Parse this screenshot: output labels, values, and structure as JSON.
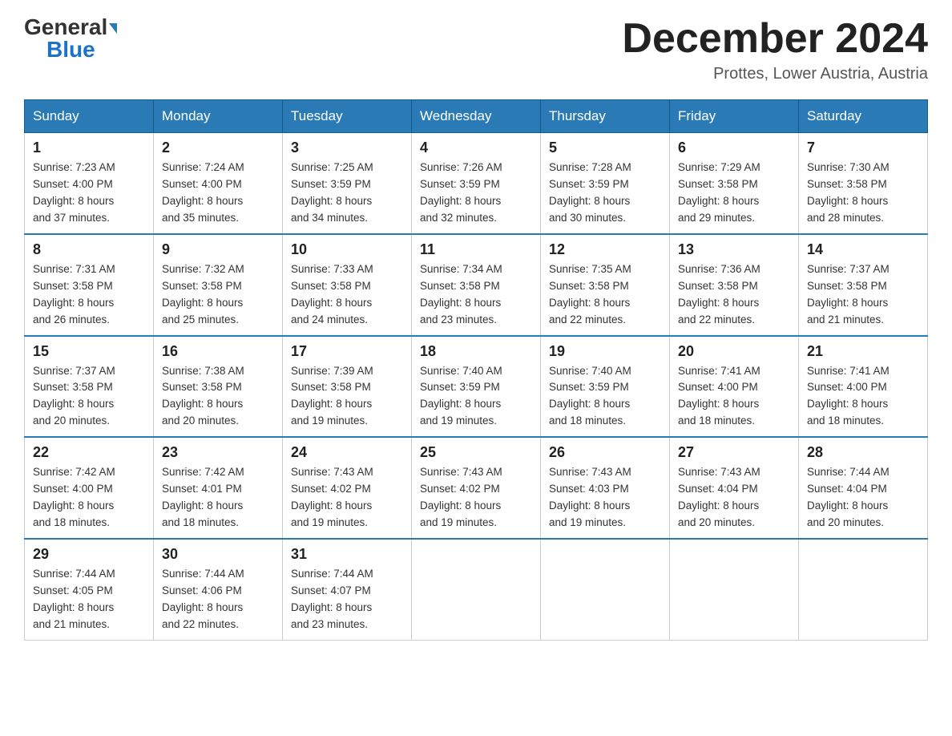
{
  "header": {
    "logo_general": "General",
    "logo_blue": "Blue",
    "month_title": "December 2024",
    "subtitle": "Prottes, Lower Austria, Austria"
  },
  "days_of_week": [
    "Sunday",
    "Monday",
    "Tuesday",
    "Wednesday",
    "Thursday",
    "Friday",
    "Saturday"
  ],
  "weeks": [
    [
      {
        "day": "1",
        "sunrise": "7:23 AM",
        "sunset": "4:00 PM",
        "daylight": "8 hours and 37 minutes."
      },
      {
        "day": "2",
        "sunrise": "7:24 AM",
        "sunset": "4:00 PM",
        "daylight": "8 hours and 35 minutes."
      },
      {
        "day": "3",
        "sunrise": "7:25 AM",
        "sunset": "3:59 PM",
        "daylight": "8 hours and 34 minutes."
      },
      {
        "day": "4",
        "sunrise": "7:26 AM",
        "sunset": "3:59 PM",
        "daylight": "8 hours and 32 minutes."
      },
      {
        "day": "5",
        "sunrise": "7:28 AM",
        "sunset": "3:59 PM",
        "daylight": "8 hours and 30 minutes."
      },
      {
        "day": "6",
        "sunrise": "7:29 AM",
        "sunset": "3:58 PM",
        "daylight": "8 hours and 29 minutes."
      },
      {
        "day": "7",
        "sunrise": "7:30 AM",
        "sunset": "3:58 PM",
        "daylight": "8 hours and 28 minutes."
      }
    ],
    [
      {
        "day": "8",
        "sunrise": "7:31 AM",
        "sunset": "3:58 PM",
        "daylight": "8 hours and 26 minutes."
      },
      {
        "day": "9",
        "sunrise": "7:32 AM",
        "sunset": "3:58 PM",
        "daylight": "8 hours and 25 minutes."
      },
      {
        "day": "10",
        "sunrise": "7:33 AM",
        "sunset": "3:58 PM",
        "daylight": "8 hours and 24 minutes."
      },
      {
        "day": "11",
        "sunrise": "7:34 AM",
        "sunset": "3:58 PM",
        "daylight": "8 hours and 23 minutes."
      },
      {
        "day": "12",
        "sunrise": "7:35 AM",
        "sunset": "3:58 PM",
        "daylight": "8 hours and 22 minutes."
      },
      {
        "day": "13",
        "sunrise": "7:36 AM",
        "sunset": "3:58 PM",
        "daylight": "8 hours and 22 minutes."
      },
      {
        "day": "14",
        "sunrise": "7:37 AM",
        "sunset": "3:58 PM",
        "daylight": "8 hours and 21 minutes."
      }
    ],
    [
      {
        "day": "15",
        "sunrise": "7:37 AM",
        "sunset": "3:58 PM",
        "daylight": "8 hours and 20 minutes."
      },
      {
        "day": "16",
        "sunrise": "7:38 AM",
        "sunset": "3:58 PM",
        "daylight": "8 hours and 20 minutes."
      },
      {
        "day": "17",
        "sunrise": "7:39 AM",
        "sunset": "3:58 PM",
        "daylight": "8 hours and 19 minutes."
      },
      {
        "day": "18",
        "sunrise": "7:40 AM",
        "sunset": "3:59 PM",
        "daylight": "8 hours and 19 minutes."
      },
      {
        "day": "19",
        "sunrise": "7:40 AM",
        "sunset": "3:59 PM",
        "daylight": "8 hours and 18 minutes."
      },
      {
        "day": "20",
        "sunrise": "7:41 AM",
        "sunset": "4:00 PM",
        "daylight": "8 hours and 18 minutes."
      },
      {
        "day": "21",
        "sunrise": "7:41 AM",
        "sunset": "4:00 PM",
        "daylight": "8 hours and 18 minutes."
      }
    ],
    [
      {
        "day": "22",
        "sunrise": "7:42 AM",
        "sunset": "4:00 PM",
        "daylight": "8 hours and 18 minutes."
      },
      {
        "day": "23",
        "sunrise": "7:42 AM",
        "sunset": "4:01 PM",
        "daylight": "8 hours and 18 minutes."
      },
      {
        "day": "24",
        "sunrise": "7:43 AM",
        "sunset": "4:02 PM",
        "daylight": "8 hours and 19 minutes."
      },
      {
        "day": "25",
        "sunrise": "7:43 AM",
        "sunset": "4:02 PM",
        "daylight": "8 hours and 19 minutes."
      },
      {
        "day": "26",
        "sunrise": "7:43 AM",
        "sunset": "4:03 PM",
        "daylight": "8 hours and 19 minutes."
      },
      {
        "day": "27",
        "sunrise": "7:43 AM",
        "sunset": "4:04 PM",
        "daylight": "8 hours and 20 minutes."
      },
      {
        "day": "28",
        "sunrise": "7:44 AM",
        "sunset": "4:04 PM",
        "daylight": "8 hours and 20 minutes."
      }
    ],
    [
      {
        "day": "29",
        "sunrise": "7:44 AM",
        "sunset": "4:05 PM",
        "daylight": "8 hours and 21 minutes."
      },
      {
        "day": "30",
        "sunrise": "7:44 AM",
        "sunset": "4:06 PM",
        "daylight": "8 hours and 22 minutes."
      },
      {
        "day": "31",
        "sunrise": "7:44 AM",
        "sunset": "4:07 PM",
        "daylight": "8 hours and 23 minutes."
      },
      null,
      null,
      null,
      null
    ]
  ],
  "labels": {
    "sunrise": "Sunrise:",
    "sunset": "Sunset:",
    "daylight": "Daylight:"
  }
}
